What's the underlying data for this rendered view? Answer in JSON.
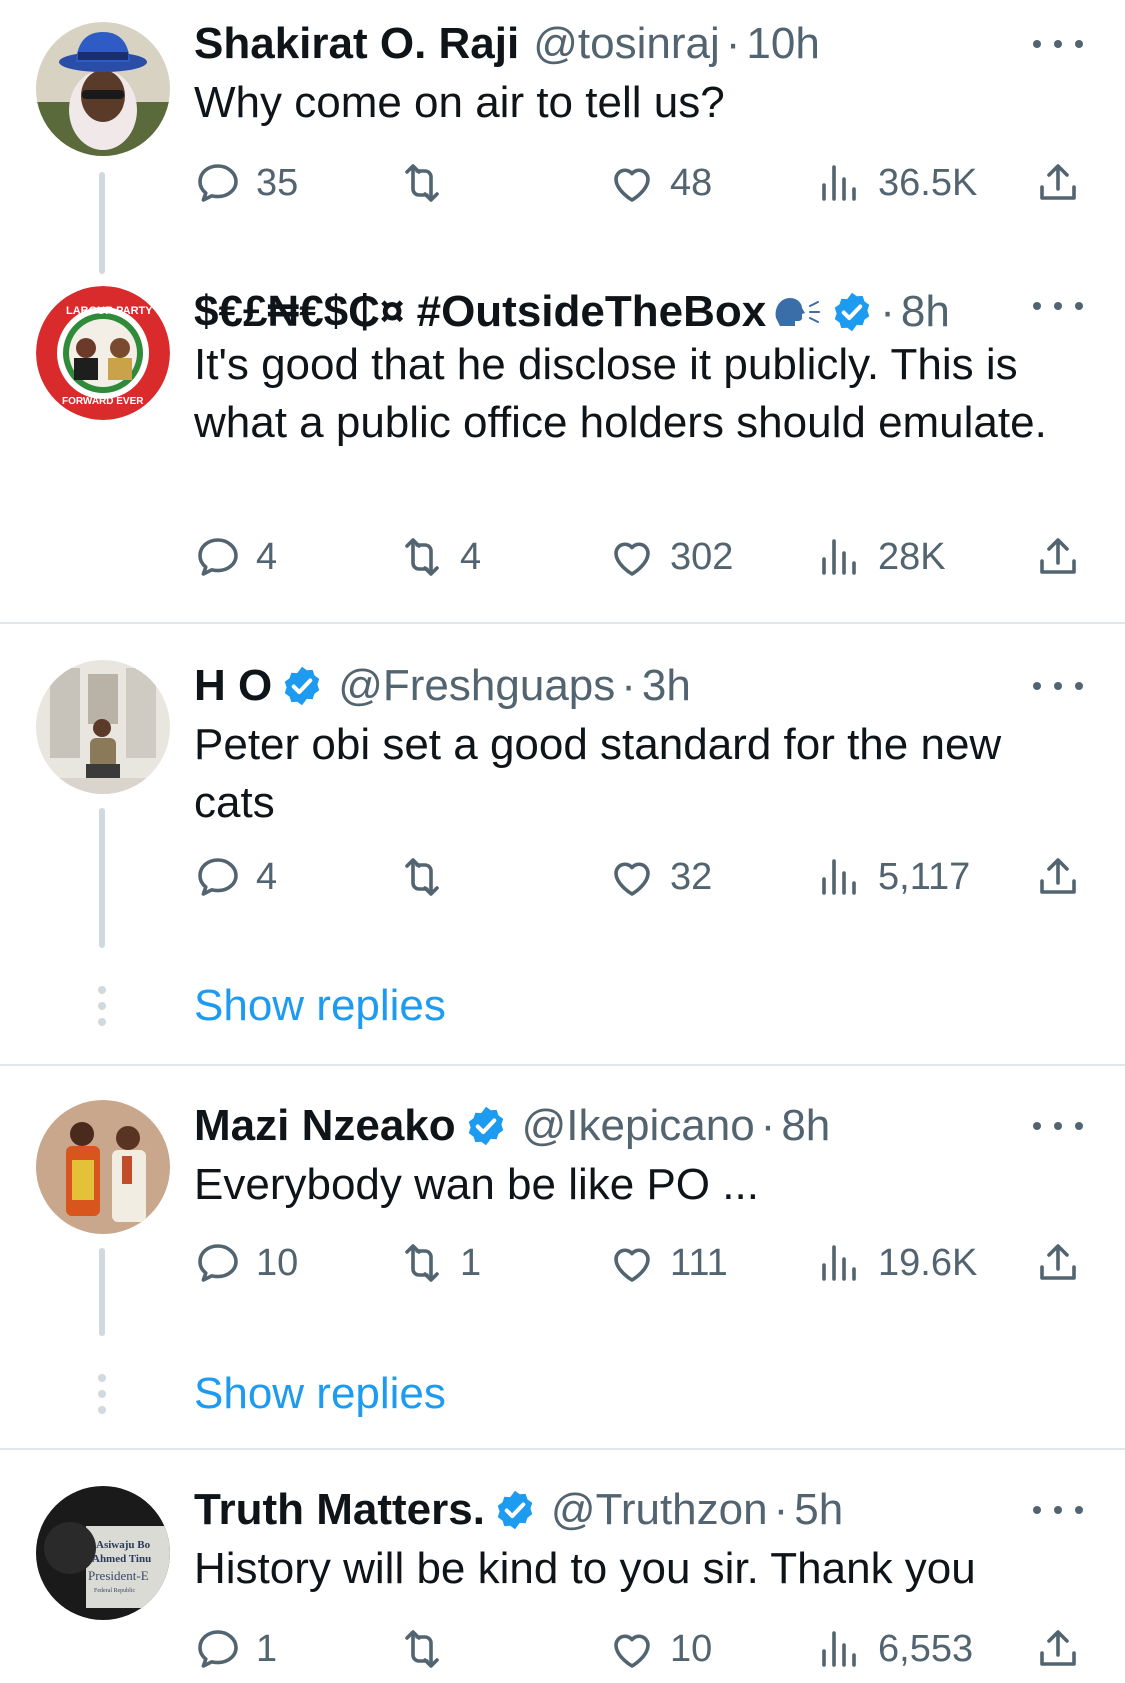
{
  "tweets": [
    {
      "name": "Shakirat O. Raji",
      "handle": "@tosinraj",
      "sep": "·",
      "time": "10h",
      "text": "Why come on air to tell us?",
      "replies": "35",
      "retweets": "",
      "likes": "48",
      "views": "36.5K",
      "verified": false
    },
    {
      "name": "$€£₦€$₵¤ #OutsideTheBox",
      "emoji": "speaking-head-icon",
      "handle": "",
      "sep": "·",
      "time": "8h",
      "text": "It's good that he disclose it publicly. This is what a public office holders should emulate.",
      "replies": "4",
      "retweets": "4",
      "likes": "302",
      "views": "28K",
      "verified": true,
      "avatar_text_top": "LABOUR PARTY",
      "avatar_text_bottom": "FORWARD EVER"
    },
    {
      "name": "H O",
      "handle": "@Freshguaps",
      "sep": "·",
      "time": "3h",
      "text": "Peter obi set a good standard for the new cats",
      "replies": "4",
      "retweets": "",
      "likes": "32",
      "views": "5,117",
      "verified": true
    },
    {
      "name": "Mazi Nzeako",
      "handle": "@Ikepicano",
      "sep": "·",
      "time": "8h",
      "text": "Everybody wan be like PO ...",
      "replies": "10",
      "retweets": "1",
      "likes": "111",
      "views": "19.6K",
      "verified": true
    },
    {
      "name": "Truth Matters.",
      "handle": "@Truthzon",
      "sep": "·",
      "time": "5h",
      "text": "History will be kind to you sir. Thank you",
      "replies": "1",
      "retweets": "",
      "likes": "10",
      "views": "6,553",
      "verified": true,
      "avatar_text": [
        "Asiwaju Bo",
        "Ahmed Tinu",
        "President-E",
        "Federal Republic"
      ]
    }
  ],
  "show_replies_label": "Show replies",
  "colors": {
    "link": "#1d9bf0",
    "secondary": "#536471",
    "verified": "#1d9bf0",
    "divider": "#e1e8ed"
  }
}
